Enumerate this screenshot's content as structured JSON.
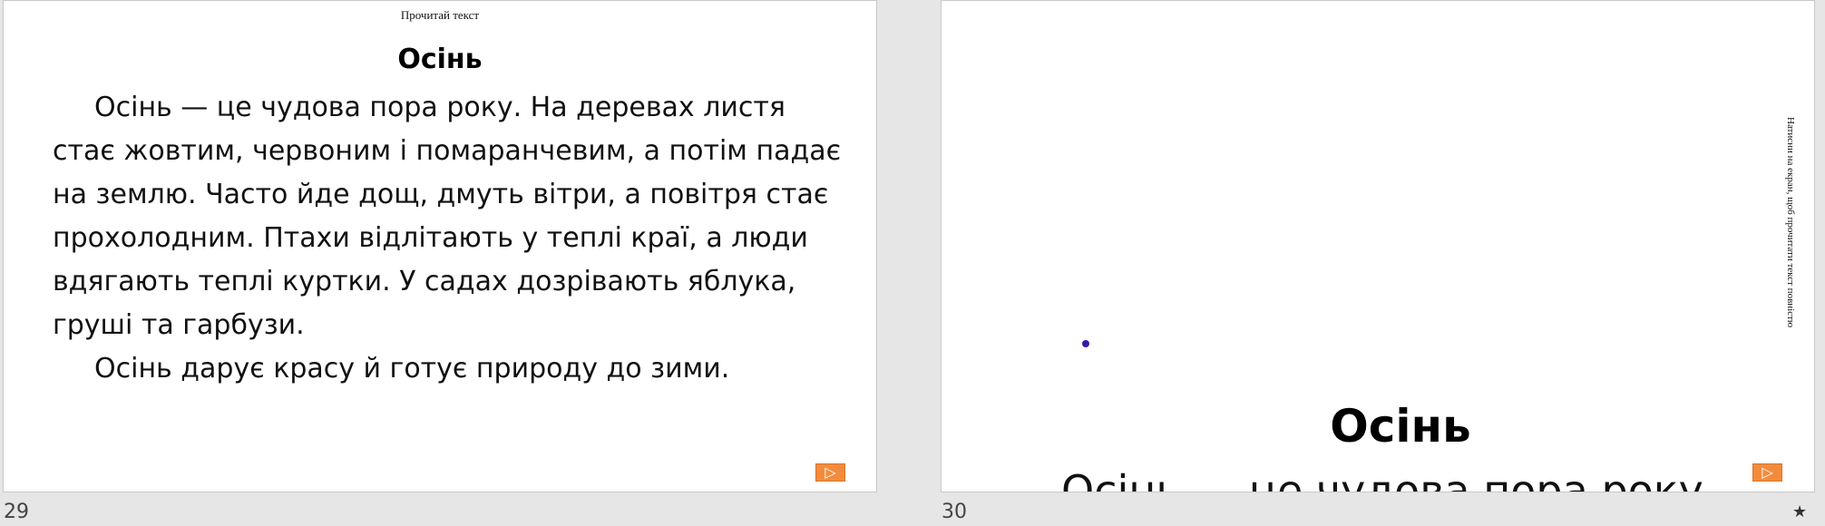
{
  "slides": [
    {
      "number": "29",
      "caption": "Прочитай текст",
      "title": "Осінь",
      "paragraph1": "Осінь — це чудова пора року. На деревах листя стає жовтим, червоним і помаранчевим, а потім падає на землю. Часто йде дощ, дмуть вітри, а повітря стає прохолодним. Птахи відлітають у теплі краї, а люди вдягають теплі куртки. У садах дозрівають яблука, груші та гарбузи.",
      "paragraph2": "Осінь дарує красу й готує природу до зими.",
      "play_icon": "▷"
    },
    {
      "number": "30",
      "vertical_note": "Натисни на екран, щоб прочитати текст повністю",
      "title": "Осінь",
      "body_fragment": "Осінь — це чудова пора року.",
      "play_icon": "▷"
    }
  ],
  "icons": {
    "play": "play-icon",
    "star": "star-icon"
  },
  "star_glyph": "★",
  "colors": {
    "play_button": "#f28c3c",
    "dot": "#3a1aa8",
    "background": "#e6e6e6"
  }
}
